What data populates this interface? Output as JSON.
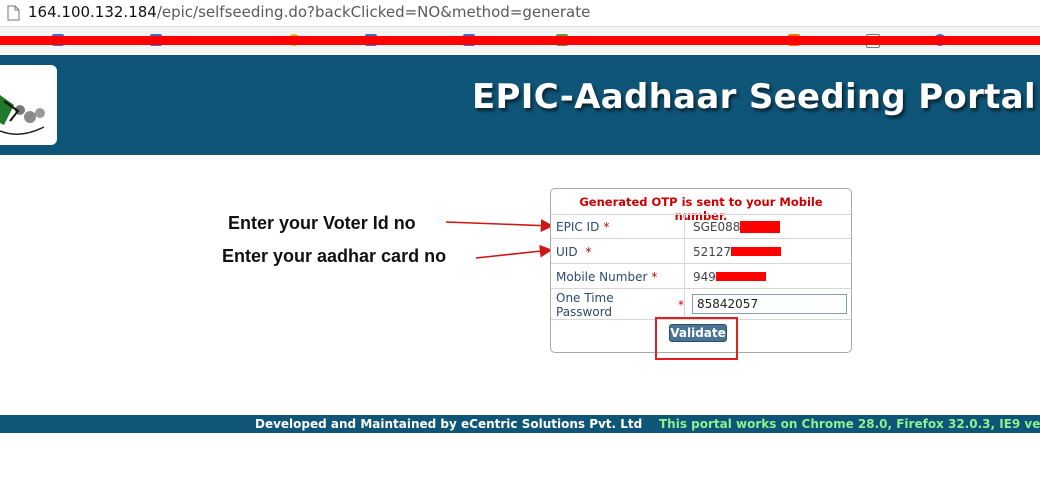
{
  "browser": {
    "url_host": "164.100.132.184",
    "url_path": "/epic/selfseeding.do?backClicked=NO&method=generate"
  },
  "header": {
    "title": "EPIC-Aadhaar Seeding Portal"
  },
  "annotations": {
    "voter_id": "Enter your Voter Id no",
    "aadhar": "Enter your aadhar card no"
  },
  "form": {
    "otp_message": "Generated OTP is sent to your Mobile number.",
    "fields": [
      {
        "label": "EPIC ID",
        "value": "SGE088"
      },
      {
        "label": "UID",
        "value": "52127"
      },
      {
        "label": "Mobile Number",
        "value": "949"
      },
      {
        "label": "One Time Password",
        "value": "85842057"
      }
    ],
    "validate_label": "Validate"
  },
  "footer": {
    "developer": "Developed and Maintained by eCentric Solutions Pvt. Ltd",
    "compat": "This portal works on Chrome 28.0, Firefox 32.0.3, IE9 ve"
  },
  "colors": {
    "banner": "#0f5578",
    "redaction": "#ff0000",
    "required": "#cc0000",
    "footer_compat": "#8ef08e"
  }
}
